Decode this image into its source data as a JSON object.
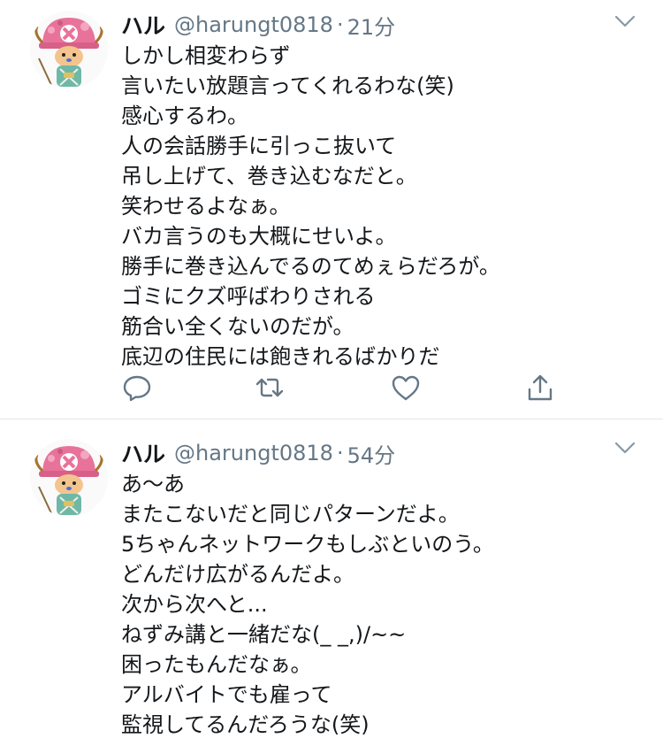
{
  "tweets": [
    {
      "name": "ハル",
      "handle": "@harungt0818",
      "separator": "·",
      "time": "21分",
      "lines": [
        "しかし相変わらず",
        "言いたい放題言ってくれるわな(笑)",
        "感心するわ。",
        "人の会話勝手に引っこ抜いて",
        "吊し上げて、巻き込むなだと。",
        "笑わせるよなぁ。",
        "バカ言うのも大概にせいよ。",
        "勝手に巻き込んでるのてめぇらだろが。",
        "ゴミにクズ呼ばわりされる",
        "筋合い全くないのだが。",
        "底辺の住民には飽きれるばかりだ"
      ]
    },
    {
      "name": "ハル",
      "handle": "@harungt0818",
      "separator": "·",
      "time": "54分",
      "lines": [
        "あ〜あ",
        "またこないだと同じパターンだよ。",
        "5ちゃんネットワークもしぶといのう。",
        "どんだけ広がるんだよ。",
        "次から次へと...",
        "ねずみ講と一緒だな(_ _,)/~~",
        "困ったもんだなぁ。",
        "アルバイトでも雇って",
        "監視してるんだろうな(笑)"
      ]
    }
  ],
  "icons": {
    "reply": "reply-icon",
    "retweet": "retweet-icon",
    "like": "like-icon",
    "share": "share-icon",
    "menu": "chevron-down-icon",
    "avatar": "chopper-avatar"
  },
  "colors": {
    "text": "#14171a",
    "secondary": "#657786",
    "divider": "#e1e8ed",
    "hat_pink": "#e8739a"
  }
}
